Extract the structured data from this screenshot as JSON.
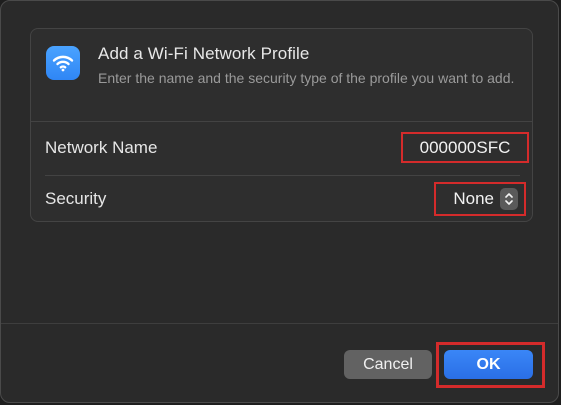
{
  "dialog": {
    "title": "Add a Wi-Fi Network Profile",
    "description": "Enter the name and the security type of the profile you want to add.",
    "icon": "wifi-icon",
    "accent_color": "#2f86f5"
  },
  "fields": {
    "network_name": {
      "label": "Network Name",
      "value": "000000SFC"
    },
    "security": {
      "label": "Security",
      "value": "None"
    }
  },
  "buttons": {
    "cancel_label": "Cancel",
    "ok_label": "OK"
  },
  "highlight_color": "#d42b2b"
}
